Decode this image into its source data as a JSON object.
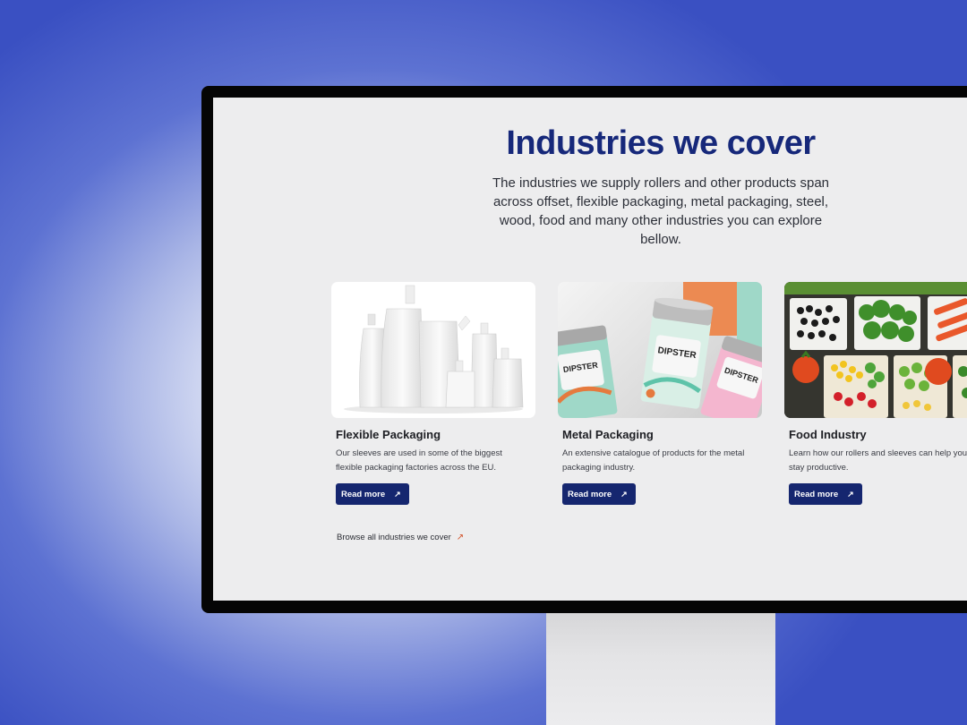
{
  "section": {
    "title": "Industries we cover",
    "subtitle": "The industries we supply rollers and other products span across offset, flexible packaging, metal packaging, steel, wood, food and many other industries you can explore bellow."
  },
  "cards": [
    {
      "title": "Flexible Packaging",
      "description": "Our sleeves are used in some of the biggest flexible packaging factories across the EU.",
      "button": "Read more",
      "image_icon": "spout-pouches-image"
    },
    {
      "title": "Metal Packaging",
      "description": "An extensive catalogue of products for the metal packaging industry.",
      "button": "Read more",
      "image_icon": "metal-tins-image",
      "can_label": "DIPSTER"
    },
    {
      "title": "Food Industry",
      "description": "Learn how our rollers and sleeves can help your machines stay productive.",
      "button": "Read more",
      "image_icon": "vegetable-platter-image"
    }
  ],
  "browse_link": "Browse all industries we cover",
  "colors": {
    "title": "#16287a",
    "button": "#15266f",
    "link_arrow": "#d2532a",
    "screen_bg": "#ededee"
  },
  "icons": {
    "button_arrow": "arrow-up-right-icon",
    "browse_arrow": "arrow-up-right-icon"
  }
}
